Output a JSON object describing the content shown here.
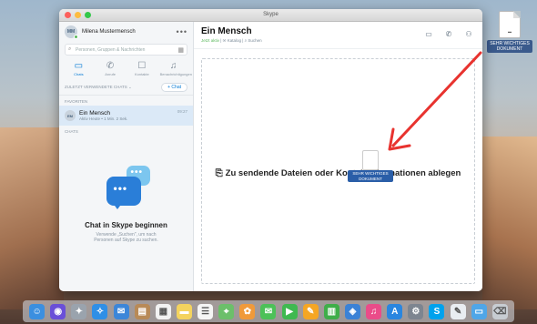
{
  "window": {
    "title": "Skype"
  },
  "desktop_file": {
    "label": "SEHR WICHTIGES DOKUMENT"
  },
  "profile": {
    "initials": "MM",
    "name": "Milena Mustermensch",
    "more": "•••"
  },
  "search": {
    "placeholder": "Personen, Gruppen & Nachrichten",
    "dialpad": "▦"
  },
  "nav_tabs": [
    {
      "label": "Chats",
      "icon": "chat-icon",
      "glyph": "▭"
    },
    {
      "label": "Anrufe",
      "icon": "phone-icon",
      "glyph": "✆"
    },
    {
      "label": "Kontakte",
      "icon": "contacts-icon",
      "glyph": "☐"
    },
    {
      "label": "Benachrichtigungen",
      "icon": "bell-icon",
      "glyph": "♫"
    }
  ],
  "recent": {
    "label": "ZULETZT VERWENDETE CHATS ⌄",
    "new_chat": "+ Chat"
  },
  "favorites_label": "FAVORITEN",
  "contact": {
    "initials": "EM",
    "name": "Ein Mensch",
    "status": "Aktiv Heute • 1 Min. 2 Sek.",
    "time": "09:27"
  },
  "chats_label": "CHATS",
  "empty_state": {
    "title": "Chat in Skype beginnen",
    "description": "Verwende „Suchen\", um nach Personen auf Skype zu suchen."
  },
  "chat_header": {
    "title": "Ein Mensch",
    "status_online": "Jetzt aktiv",
    "status_rest": " | ✉ Katalog | ⌕ Suchen",
    "actions": [
      {
        "name": "video-call-icon",
        "glyph": "▭"
      },
      {
        "name": "audio-call-icon",
        "glyph": "✆"
      },
      {
        "name": "add-person-icon",
        "glyph": "⚇"
      }
    ]
  },
  "dropzone": {
    "text": "Zu sendende Dateien oder Kontaktinformationen ablegen",
    "clip": "⎘"
  },
  "drag_ghost": {
    "label": "SEHR WICHTIGES DOKUMENT"
  },
  "accent_color": "#0078d4",
  "arrow_color": "#e8332f",
  "dock_items": [
    {
      "name": "finder-icon",
      "color": "#3b8fe0",
      "glyph": "☺"
    },
    {
      "name": "siri-icon",
      "color": "#6a4fd8",
      "glyph": "◉"
    },
    {
      "name": "launchpad-icon",
      "color": "#9aa3ad",
      "glyph": "✦"
    },
    {
      "name": "safari-icon",
      "color": "#2f8fe6",
      "glyph": "✧"
    },
    {
      "name": "mail-icon",
      "color": "#3c86d8",
      "glyph": "✉"
    },
    {
      "name": "contacts-app-icon",
      "color": "#b88a57",
      "glyph": "▤"
    },
    {
      "name": "calendar-icon",
      "color": "#f2f2f2",
      "glyph": "▦"
    },
    {
      "name": "notes-icon",
      "color": "#f4d35e",
      "glyph": "▬"
    },
    {
      "name": "reminders-icon",
      "color": "#f5f5f5",
      "glyph": "☰"
    },
    {
      "name": "maps-icon",
      "color": "#6cbf6a",
      "glyph": "⌖"
    },
    {
      "name": "photos-icon",
      "color": "#f09a3a",
      "glyph": "✿"
    },
    {
      "name": "messages-icon",
      "color": "#4cc158",
      "glyph": "✉"
    },
    {
      "name": "facetime-icon",
      "color": "#3fb950",
      "glyph": "▶"
    },
    {
      "name": "pages-icon",
      "color": "#f5a623",
      "glyph": "✎"
    },
    {
      "name": "numbers-icon",
      "color": "#3fae49",
      "glyph": "▥"
    },
    {
      "name": "keynote-icon",
      "color": "#3b82d6",
      "glyph": "◈"
    },
    {
      "name": "itunes-icon",
      "color": "#ea4c89",
      "glyph": "♫"
    },
    {
      "name": "app-store-icon",
      "color": "#2a86e0",
      "glyph": "A"
    },
    {
      "name": "system-preferences-icon",
      "color": "#7d8590",
      "glyph": "⚙"
    },
    {
      "name": "skype-icon",
      "color": "#00a2ed",
      "glyph": "S"
    },
    {
      "name": "textedit-icon",
      "color": "#e9edf2",
      "glyph": "✎"
    },
    {
      "name": "downloads-folder-icon",
      "color": "#4fa6e8",
      "glyph": "▭"
    },
    {
      "name": "trash-icon",
      "color": "#c7ccd2",
      "glyph": "⌫"
    }
  ]
}
